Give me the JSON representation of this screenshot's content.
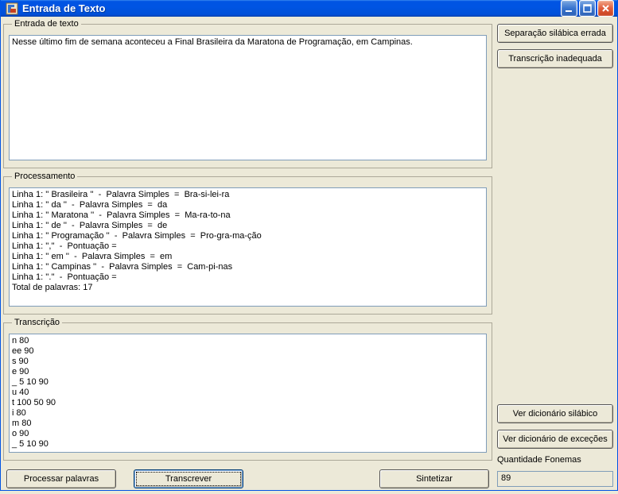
{
  "window": {
    "title": "Entrada de Texto"
  },
  "groups": {
    "entrada": "Entrada de texto",
    "process": "Processamento",
    "transc": "Transcrição"
  },
  "entrada_text": "Nesse último fim de semana aconteceu a Final Brasileira da Maratona de Programação, em Campinas.",
  "process_text": "Linha 1: '' Brasileira ''  -  Palavra Simples  =  Bra-si-lei-ra\nLinha 1: '' da ''  -  Palavra Simples  =  da\nLinha 1: '' Maratona ''  -  Palavra Simples  =  Ma-ra-to-na\nLinha 1: '' de ''  -  Palavra Simples  =  de\nLinha 1: '' Programação ''  -  Palavra Simples  =  Pro-gra-ma-ção\nLinha 1: '',''  -  Pontuação =\nLinha 1: '' em ''  -  Palavra Simples  =  em\nLinha 1: '' Campinas ''  -  Palavra Simples  =  Cam-pi-nas\nLinha 1: ''.''  -  Pontuação =\nTotal de palavras: 17",
  "transc_text": "n 80\nee 90\ns 90\ne 90\n_ 5 10 90\nu 40\nt 100 50 90\ni 80\nm 80\no 90\n_ 5 10 90",
  "buttons": {
    "processar": "Processar palavras",
    "transcrever": "Transcrever",
    "sintetizar": "Sintetizar",
    "sep_errada": "Separação silábica errada",
    "transc_inadeq": "Transcrição inadequada",
    "ver_dic_sil": "Ver dicionário silábico",
    "ver_dic_exc": "Ver dicionário de exceções"
  },
  "qtd": {
    "label": "Quantidade Fonemas",
    "value": "89"
  }
}
